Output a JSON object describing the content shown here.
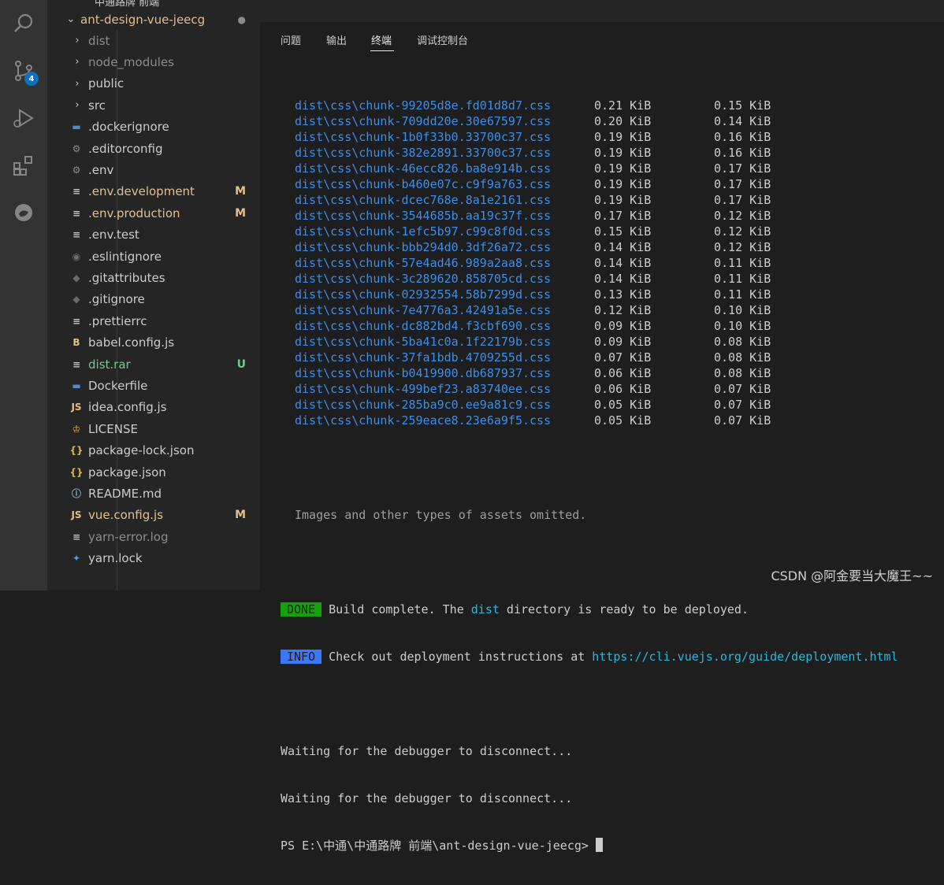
{
  "activity_bar": {
    "source_control_badge": "4"
  },
  "explorer": {
    "header": "中通路牌 前端",
    "root": {
      "label": "ant-design-vue-jeecg",
      "status": "●"
    },
    "items": [
      {
        "label": "dist",
        "type": "folder",
        "icon": "chevron-right-icon",
        "color": "#8c8c8c",
        "status": ""
      },
      {
        "label": "node_modules",
        "type": "folder",
        "icon": "chevron-right-icon",
        "color": "#8c8c8c",
        "status": ""
      },
      {
        "label": "public",
        "type": "folder",
        "icon": "chevron-right-icon",
        "color": "#cccccc",
        "status": ""
      },
      {
        "label": "src",
        "type": "folder",
        "icon": "chevron-right-icon",
        "color": "#cccccc",
        "status": ""
      },
      {
        "label": ".dockerignore",
        "type": "file",
        "icon": "docker-icon",
        "color": "#cccccc",
        "status": ""
      },
      {
        "label": ".editorconfig",
        "type": "file",
        "icon": "gear-icon",
        "color": "#cccccc",
        "status": ""
      },
      {
        "label": ".env",
        "type": "file",
        "icon": "gear-icon",
        "color": "#cccccc",
        "status": ""
      },
      {
        "label": ".env.development",
        "type": "file",
        "icon": "lines-icon",
        "color": "#e2c08d",
        "status": "M"
      },
      {
        "label": ".env.production",
        "type": "file",
        "icon": "lines-icon",
        "color": "#e2c08d",
        "status": "M"
      },
      {
        "label": ".env.test",
        "type": "file",
        "icon": "lines-icon",
        "color": "#cccccc",
        "status": ""
      },
      {
        "label": ".eslintignore",
        "type": "file",
        "icon": "circle-icon",
        "color": "#cccccc",
        "status": ""
      },
      {
        "label": ".gitattributes",
        "type": "file",
        "icon": "git-icon",
        "color": "#cccccc",
        "status": ""
      },
      {
        "label": ".gitignore",
        "type": "file",
        "icon": "git-icon",
        "color": "#cccccc",
        "status": ""
      },
      {
        "label": ".prettierrc",
        "type": "file",
        "icon": "lines-icon",
        "color": "#cccccc",
        "status": ""
      },
      {
        "label": "babel.config.js",
        "type": "file",
        "icon": "babel-icon",
        "color": "#cccccc",
        "status": ""
      },
      {
        "label": "dist.rar",
        "type": "file",
        "icon": "lines-icon",
        "color": "#73c991",
        "status": "U"
      },
      {
        "label": "Dockerfile",
        "type": "file",
        "icon": "docker-icon",
        "color": "#cccccc",
        "status": ""
      },
      {
        "label": "idea.config.js",
        "type": "file",
        "icon": "js-icon",
        "color": "#cccccc",
        "status": ""
      },
      {
        "label": "LICENSE",
        "type": "file",
        "icon": "license-icon",
        "color": "#cccccc",
        "status": ""
      },
      {
        "label": "package-lock.json",
        "type": "file",
        "icon": "json-icon",
        "color": "#cccccc",
        "status": ""
      },
      {
        "label": "package.json",
        "type": "file",
        "icon": "json-icon",
        "color": "#cccccc",
        "status": ""
      },
      {
        "label": "README.md",
        "type": "file",
        "icon": "info-icon",
        "color": "#cccccc",
        "status": ""
      },
      {
        "label": "vue.config.js",
        "type": "file",
        "icon": "js-icon",
        "color": "#e2c08d",
        "status": "M"
      },
      {
        "label": "yarn-error.log",
        "type": "file",
        "icon": "lines-icon",
        "color": "#8c8c8c",
        "status": ""
      },
      {
        "label": "yarn.lock",
        "type": "file",
        "icon": "yarn-icon",
        "color": "#cccccc",
        "status": ""
      }
    ]
  },
  "panel": {
    "tabs": [
      {
        "label": "问题",
        "active": false
      },
      {
        "label": "输出",
        "active": false
      },
      {
        "label": "终端",
        "active": true
      },
      {
        "label": "调试控制台",
        "active": false
      }
    ]
  },
  "terminal": {
    "assets": [
      {
        "file": "dist\\css\\chunk-99205d8e.fd01d8d7.css",
        "size": "0.21 KiB",
        "gzipped": "0.15 KiB"
      },
      {
        "file": "dist\\css\\chunk-709dd20e.30e67597.css",
        "size": "0.20 KiB",
        "gzipped": "0.14 KiB"
      },
      {
        "file": "dist\\css\\chunk-1b0f33b0.33700c37.css",
        "size": "0.19 KiB",
        "gzipped": "0.16 KiB"
      },
      {
        "file": "dist\\css\\chunk-382e2891.33700c37.css",
        "size": "0.19 KiB",
        "gzipped": "0.16 KiB"
      },
      {
        "file": "dist\\css\\chunk-46ecc826.ba8e914b.css",
        "size": "0.19 KiB",
        "gzipped": "0.17 KiB"
      },
      {
        "file": "dist\\css\\chunk-b460e07c.c9f9a763.css",
        "size": "0.19 KiB",
        "gzipped": "0.17 KiB"
      },
      {
        "file": "dist\\css\\chunk-dcec768e.8a1e2161.css",
        "size": "0.19 KiB",
        "gzipped": "0.17 KiB"
      },
      {
        "file": "dist\\css\\chunk-3544685b.aa19c37f.css",
        "size": "0.17 KiB",
        "gzipped": "0.12 KiB"
      },
      {
        "file": "dist\\css\\chunk-1efc5b97.c99c8f0d.css",
        "size": "0.15 KiB",
        "gzipped": "0.12 KiB"
      },
      {
        "file": "dist\\css\\chunk-bbb294d0.3df26a72.css",
        "size": "0.14 KiB",
        "gzipped": "0.12 KiB"
      },
      {
        "file": "dist\\css\\chunk-57e4ad46.989a2aa8.css",
        "size": "0.14 KiB",
        "gzipped": "0.11 KiB"
      },
      {
        "file": "dist\\css\\chunk-3c289620.858705cd.css",
        "size": "0.14 KiB",
        "gzipped": "0.11 KiB"
      },
      {
        "file": "dist\\css\\chunk-02932554.58b7299d.css",
        "size": "0.13 KiB",
        "gzipped": "0.11 KiB"
      },
      {
        "file": "dist\\css\\chunk-7e4776a3.42491a5e.css",
        "size": "0.12 KiB",
        "gzipped": "0.10 KiB"
      },
      {
        "file": "dist\\css\\chunk-dc882bd4.f3cbf690.css",
        "size": "0.09 KiB",
        "gzipped": "0.10 KiB"
      },
      {
        "file": "dist\\css\\chunk-5ba41c0a.1f22179b.css",
        "size": "0.09 KiB",
        "gzipped": "0.08 KiB"
      },
      {
        "file": "dist\\css\\chunk-37fa1bdb.4709255d.css",
        "size": "0.07 KiB",
        "gzipped": "0.08 KiB"
      },
      {
        "file": "dist\\css\\chunk-b0419900.db687937.css",
        "size": "0.06 KiB",
        "gzipped": "0.08 KiB"
      },
      {
        "file": "dist\\css\\chunk-499bef23.a83740ee.css",
        "size": "0.06 KiB",
        "gzipped": "0.07 KiB"
      },
      {
        "file": "dist\\css\\chunk-285ba9c0.ee9a81c9.css",
        "size": "0.05 KiB",
        "gzipped": "0.07 KiB"
      },
      {
        "file": "dist\\css\\chunk-259eace8.23e6a9f5.css",
        "size": "0.05 KiB",
        "gzipped": "0.07 KiB"
      }
    ],
    "omitted_note": "Images and other types of assets omitted.",
    "done_tag": "DONE",
    "done_pre": "Build complete. The ",
    "done_dir": "dist",
    "done_post": " directory is ready to be deployed.",
    "info_tag": "INFO",
    "info_pre": "Check out deployment instructions at ",
    "info_url": "https://cli.vuejs.org/guide/deployment.html",
    "waiting_1": "Waiting for the debugger to disconnect...",
    "waiting_2": "Waiting for the debugger to disconnect...",
    "prompt": "PS E:\\中通\\中通路牌 前端\\ant-design-vue-jeecg> "
  },
  "watermark": "CSDN @阿金要当大魔王~~"
}
